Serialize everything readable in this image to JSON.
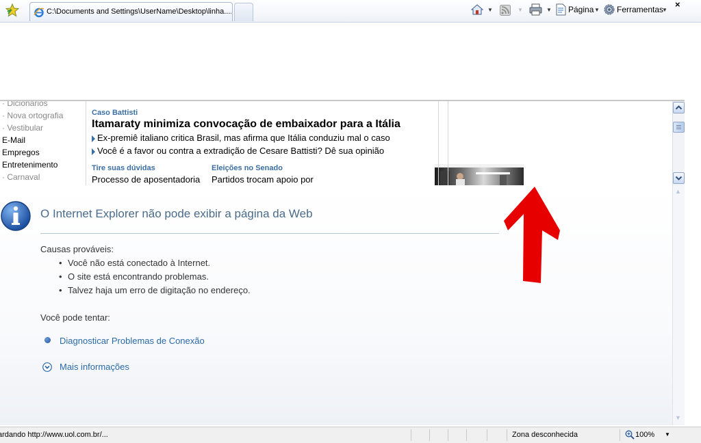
{
  "toolbar": {
    "tab_title": "C:\\Documents and Settings\\UserName\\Desktop\\linha....",
    "page_label": "Página",
    "tools_label": "Ferramentas",
    "close_glyph": "×",
    "icons": [
      "favorites-star-icon",
      "ie-page-icon",
      "home-icon",
      "feeds-icon",
      "print-icon",
      "page-icon",
      "gear-icon"
    ]
  },
  "frame": {
    "menu": [
      {
        "label": "· Dicionários",
        "style": "gray"
      },
      {
        "label": "· Nova ortografia",
        "style": "gray"
      },
      {
        "label": "· Vestibular",
        "style": "gray"
      },
      {
        "label": "E-Mail",
        "style": "black"
      },
      {
        "label": "Empregos",
        "style": "black"
      },
      {
        "label": "Entretenimento",
        "style": "black"
      },
      {
        "label": "· Carnaval",
        "style": "gray"
      }
    ],
    "news": {
      "kicker": "Caso Battisti",
      "headline": "Itamaraty minimiza convocação de embaixador para a Itália",
      "sub1": "Ex-premiê italiano critica Brasil, mas afirma que Itália conduziu mal o caso",
      "sub2": "Você é a favor ou contra a extradição de Cesare Battisti? Dê sua opinião",
      "section1_title": "Tire suas dúvidas",
      "section1_text": "Processo de aposentadoria",
      "section2_title": "Eleições no Senado",
      "section2_text": "Partidos trocam apoio por"
    }
  },
  "error": {
    "title": "O Internet Explorer não pode exibir a página da Web",
    "causes_title": "Causas prováveis:",
    "causes": [
      "Você não está conectado à Internet.",
      "O site está encontrando problemas.",
      "Talvez haja um erro de digitação no endereço."
    ],
    "try_title": "Você pode tentar:",
    "diagnose_link": "Diagnosticar Problemas de Conexão",
    "more_info_link": "Mais informações"
  },
  "status": {
    "text": "ardando http://www.uol.com.br/...",
    "zone": "Zona desconhecida",
    "zoom": "100%"
  },
  "colors": {
    "link": "#2a6aa8",
    "title": "#4a6b8a",
    "news_blue": "#3a6ea5",
    "annotation_arrow": "#e60000"
  }
}
